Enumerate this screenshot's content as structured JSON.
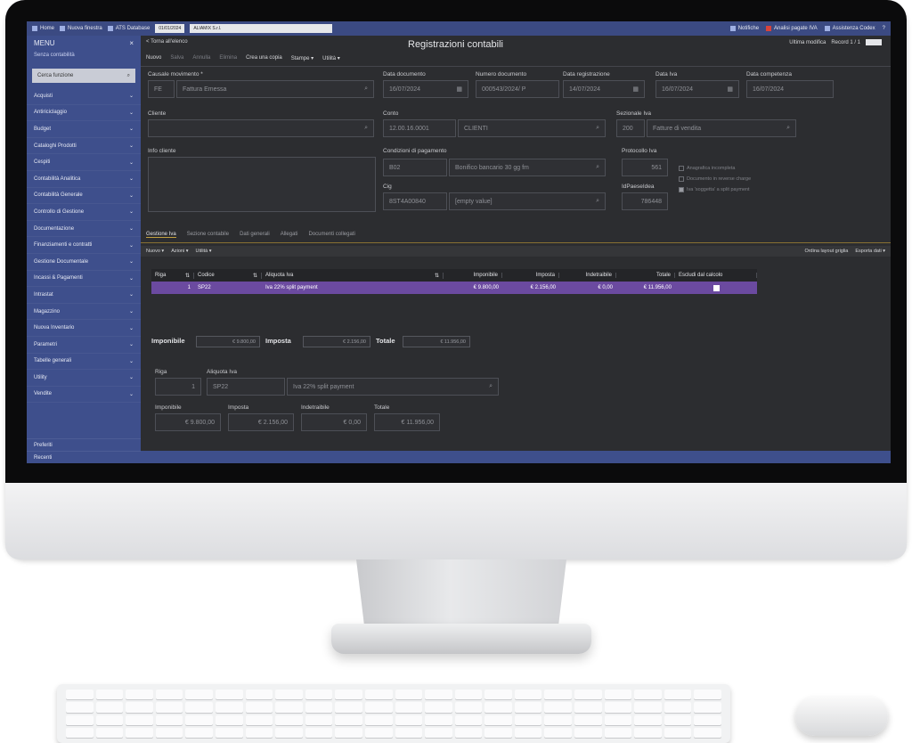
{
  "topbar": {
    "items": [
      "Home",
      "Nuova finestra",
      "ATS Database",
      "01/01/2024",
      "ALIAMIX S.r.l."
    ],
    "right_items": [
      "Notifiche",
      "Analisi pagate IVA",
      "Assistenza Codex"
    ],
    "right_end": "?"
  },
  "sidebar": {
    "title": "MENU",
    "close": "×",
    "subtitle": "Senza contabilità",
    "search_placeholder": "Cerca funzione",
    "items": [
      "Acquisti",
      "Antiriciclaggio",
      "Budget",
      "Cataloghi Prodotti",
      "Cespiti",
      "Contabilità Analitica",
      "Contabilità Generale",
      "Controllo di Gestione",
      "Documentazione",
      "Finanziamenti e contratti",
      "Gestione Documentale",
      "Incassi & Pagamenti",
      "Intrastat",
      "Magazzino",
      "Nuova Inventario",
      "Parametri",
      "Tabelle generali",
      "Utility",
      "Vendite"
    ],
    "bottom": [
      "Preferiti",
      "Recenti"
    ]
  },
  "main": {
    "breadcrumb": "< Torna all'elenco",
    "title": "Registrazioni contabili",
    "right_controls": [
      "Ultima modifica",
      "Record 1 / 1"
    ],
    "menu": [
      "Nuovo",
      "Salva",
      "Annulla",
      "Elimina",
      "Crea una copia",
      "Stampe ▾",
      "Utilità ▾"
    ],
    "fields": {
      "causale_label": "Causale movimento *",
      "causale_code": "FE",
      "causale_value": "Fattura Emessa",
      "data_doc_label": "Data documento",
      "data_doc": "16/07/2024",
      "num_doc_label": "Numero documento",
      "num_doc": "000543/2024/ P",
      "data_reg_label": "Data registrazione",
      "data_reg": "14/07/2024",
      "data_iva_label": "Data Iva",
      "data_iva": "16/07/2024",
      "data_comp_label": "Data competenza",
      "data_comp": "16/07/2024",
      "cliente_label": "Cliente",
      "cliente_value": "",
      "conto_label": "Conto",
      "conto_code": "12.00.16.0001",
      "conto_value": "CLIENTI",
      "sezionale_label": "Sezionale Iva",
      "sezionale_code": "200",
      "sezionale_value": "Fatture di vendita",
      "info_label": "Info cliente",
      "condizioni_label": "Condizioni di pagamento",
      "condizioni_code": "B02",
      "condizioni_value": "Bonifico bancario 30 gg fm",
      "protocollo_label": "Protocollo Iva",
      "protocollo_value": "561",
      "cig_label": "Cig",
      "cig_code": "8ST4A00840",
      "cig_value": "[empty value]",
      "ipa_label": "IdPaeseIdea",
      "ipa_value": "786448",
      "check1": "Anagrafica incompleta",
      "check2": "Documento in reverse charge",
      "check3": "Iva 'soggetta' a split payment"
    },
    "tabs": [
      "Gestione Iva",
      "Sezione contabile",
      "Dati generali",
      "Allegati",
      "Documenti collegati"
    ],
    "toolbar": [
      "Nuovo ▾",
      "Azioni ▾",
      "Utilità ▾"
    ],
    "toolbar_right": [
      "Ordina layout griglia",
      "Esporta dati ▾"
    ],
    "grid": {
      "headers": [
        "Riga",
        "Codice",
        "Aliquota Iva",
        "Imponibile",
        "Imposta",
        "Indetraibile",
        "Totale",
        "Escludi dal calcolo"
      ],
      "rows": [
        {
          "riga": "1",
          "codice": "SP22",
          "aliquota": "Iva 22% split payment",
          "imponibile": "€ 9.800,00",
          "imposta": "€ 2.156,00",
          "indetraibile": "€ 0,00",
          "totale": "€ 11.956,00"
        }
      ]
    },
    "totals": {
      "imponibile_label": "Imponibile",
      "imponibile": "€ 9.800,00",
      "imposta_label": "Imposta",
      "imposta": "€ 2.156,00",
      "totale_label": "Totale",
      "totale": "€ 11.956,00"
    },
    "detail": {
      "riga_label": "Riga",
      "riga": "1",
      "aliquota_label": "Aliquota Iva",
      "aliquota_code": "SP22",
      "aliquota_value": "Iva 22% split payment",
      "imponibile_label": "Imponibile",
      "imponibile": "€ 9.800,00",
      "imposta_label": "Imposta",
      "imposta": "€ 2.156,00",
      "indetraibile_label": "Indetraibile",
      "indetraibile": "€ 0,00",
      "totale_label": "Totale",
      "totale": "€ 11.956,00"
    }
  },
  "colors": {
    "sidebar": "#3e4f8c",
    "selected_row": "#6b4aa0",
    "background": "#2c2d30"
  }
}
